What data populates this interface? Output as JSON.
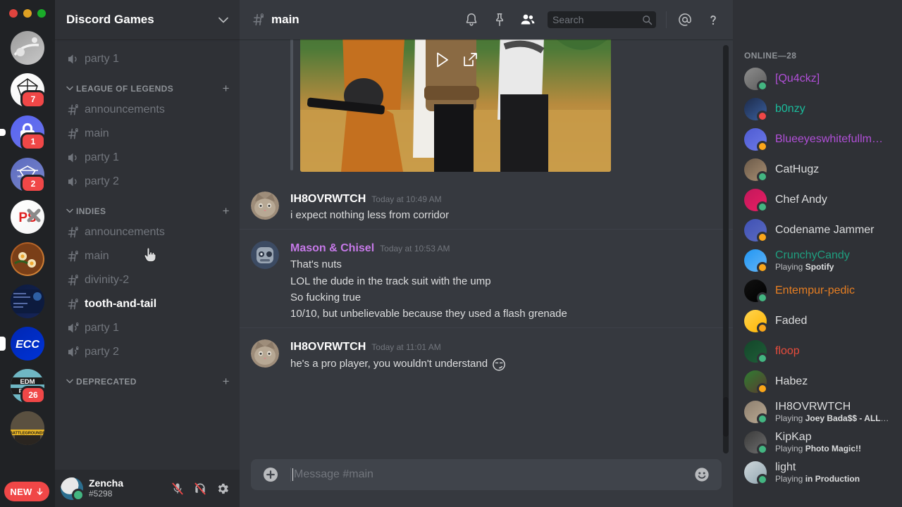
{
  "window": {
    "traffic_lights": [
      "close",
      "minimize",
      "maximize"
    ]
  },
  "server_rail": {
    "servers": [
      {
        "name": "mototrials-server",
        "badge": null,
        "pill": null,
        "colors": [
          "#9b9b9b",
          "#c8c8c8"
        ]
      },
      {
        "name": "owsla-server",
        "badge": "7",
        "pill": null,
        "colors": [
          "#ffffff",
          "#f2f2f2"
        ]
      },
      {
        "name": "lock-server",
        "badge": "1",
        "pill": "sm",
        "colors": [
          "#5865f2",
          "#6b74e8"
        ]
      },
      {
        "name": "hypesquad-server",
        "badge": "2",
        "pill": null,
        "colors": [
          "#5c6bc0",
          "#7986cb"
        ]
      },
      {
        "name": "red-pixel-server",
        "badge": null,
        "pill": null,
        "colors": [
          "#ffffff",
          "#f5f5f5"
        ]
      },
      {
        "name": "ramen-server",
        "badge": null,
        "pill": null,
        "colors": [
          "#a8541f",
          "#d98c3c"
        ]
      },
      {
        "name": "congratulations-server",
        "badge": null,
        "pill": null,
        "colors": [
          "#0d1b3e",
          "#16255a"
        ]
      },
      {
        "name": "ecc-server",
        "badge": null,
        "pill": "md",
        "colors": [
          "#0027b3",
          "#0033d6"
        ]
      },
      {
        "name": "edm-prod-server",
        "badge": "26",
        "pill": null,
        "colors": [
          "#6fb7c4",
          "#2b2b2b"
        ]
      },
      {
        "name": "battlegrounds-server",
        "badge": null,
        "pill": null,
        "colors": [
          "#4a4236",
          "#6b5f4c"
        ]
      }
    ],
    "new_pill_label": "NEW"
  },
  "sidebar": {
    "guild_name": "Discord Games",
    "collapse_icon": "chevron-down-icon",
    "orphan_channels": [
      {
        "label": "party 1",
        "type": "voice",
        "locked": false,
        "active": false
      }
    ],
    "categories": [
      {
        "label": "LEAGUE OF LEGENDS",
        "channels": [
          {
            "label": "announcements",
            "type": "text",
            "locked": true,
            "active": false
          },
          {
            "label": "main",
            "type": "text",
            "locked": true,
            "active": false
          },
          {
            "label": "party 1",
            "type": "voice",
            "locked": false,
            "active": false
          },
          {
            "label": "party 2",
            "type": "voice",
            "locked": false,
            "active": false
          }
        ]
      },
      {
        "label": "INDIES",
        "channels": [
          {
            "label": "announcements",
            "type": "text",
            "locked": true,
            "active": false
          },
          {
            "label": "main",
            "type": "text",
            "locked": true,
            "active": false
          },
          {
            "label": "divinity-2",
            "type": "text",
            "locked": true,
            "active": false
          },
          {
            "label": "tooth-and-tail",
            "type": "text",
            "locked": true,
            "active": true
          },
          {
            "label": "party 1",
            "type": "voice",
            "locked": true,
            "active": false
          },
          {
            "label": "party 2",
            "type": "voice",
            "locked": true,
            "active": false
          }
        ]
      },
      {
        "label": "DEPRECATED",
        "channels": []
      }
    ],
    "add_channel_icon": "plus-icon",
    "user_panel": {
      "username": "Zencha",
      "discriminator": "#5298",
      "status": "online",
      "mic_icon": "microphone-muted-icon",
      "headset_icon": "headset-deafened-icon",
      "settings_icon": "gear-icon"
    }
  },
  "header": {
    "channel_name": "main",
    "channel_icon": "hash-locked-icon",
    "actions": [
      {
        "name": "notifications-bell-icon",
        "glyph": "bell"
      },
      {
        "name": "pinned-messages-icon",
        "glyph": "pin"
      },
      {
        "name": "member-list-icon",
        "glyph": "people"
      }
    ],
    "search": {
      "placeholder": "Search",
      "icon": "search-icon",
      "value": ""
    },
    "mentions_icon": "at-mention-icon",
    "help_icon": "help-question-icon"
  },
  "chat": {
    "embed": {
      "type": "video-embed",
      "play_icon": "play-triangle-icon",
      "popout_icon": "popout-external-icon",
      "alt": "Four airsoft players posing with rifles in a forest"
    },
    "messages": [
      {
        "author": "IH8OVRWTCH",
        "author_color": "#ffffff",
        "timestamp": "Today at 10:49 AM",
        "avatar": "cat-avatar",
        "lines": [
          "i expect nothing less from corridor"
        ],
        "emoji": ""
      },
      {
        "author": "Mason & Chisel",
        "author_color": "#c679e8",
        "timestamp": "Today at 10:53 AM",
        "avatar": "robot-avatar",
        "lines": [
          "That's nuts",
          "LOL the dude in the track suit with the ump",
          "So fucking true",
          "10/10, but unbelievable because they used a flash grenade"
        ],
        "emoji": ""
      },
      {
        "author": "IH8OVRWTCH",
        "author_color": "#ffffff",
        "timestamp": "Today at 11:01 AM",
        "avatar": "cat-avatar",
        "lines": [
          "he's a pro player, you wouldn't understand"
        ],
        "emoji": "😏"
      }
    ],
    "composer": {
      "placeholder": "Message #main",
      "value": "",
      "attach_icon": "plus-circle-icon",
      "emoji_icon": "emoji-smiley-icon"
    }
  },
  "members": {
    "header": "ONLINE—28",
    "list": [
      {
        "name": "[Qu4ckz]",
        "color": "#b14fd8",
        "status": "online",
        "activity": null,
        "activity_app": null,
        "avatar": [
          "#8d8d8d",
          "#5b5b5b"
        ]
      },
      {
        "name": "b0nzy",
        "color": "#1abc9c",
        "status": "dnd",
        "activity": null,
        "activity_app": null,
        "avatar": [
          "#1d2b4a",
          "#3a5f9e"
        ]
      },
      {
        "name": "Blueeyeswhitefullm…",
        "color": "#b14fd8",
        "status": "idle",
        "activity": null,
        "activity_app": null,
        "avatar": [
          "#4e5bd2",
          "#6d7ae8"
        ]
      },
      {
        "name": "CatHugz",
        "color": "#dcddde",
        "status": "online",
        "activity": null,
        "activity_app": null,
        "avatar": [
          "#6b5a49",
          "#a88e72"
        ]
      },
      {
        "name": "Chef Andy",
        "color": "#dcddde",
        "status": "online",
        "activity": null,
        "activity_app": null,
        "avatar": [
          "#c2185b",
          "#e91e63"
        ]
      },
      {
        "name": "Codename Jammer",
        "color": "#dcddde",
        "status": "idle",
        "activity": null,
        "activity_app": null,
        "avatar": [
          "#3f51b5",
          "#5c6bc0"
        ]
      },
      {
        "name": "CrunchyCandy",
        "color": "#1f9e7f",
        "status": "idle",
        "activity": "Playing",
        "activity_app": "Spotify",
        "avatar": [
          "#2196f3",
          "#64b5f6"
        ]
      },
      {
        "name": "Entempur-pedic",
        "color": "#e67e22",
        "status": "online",
        "activity": null,
        "activity_app": null,
        "avatar": [
          "#111111",
          "#000000"
        ]
      },
      {
        "name": "Faded",
        "color": "#dcddde",
        "status": "idle",
        "activity": null,
        "activity_app": null,
        "avatar": [
          "#ffd54f",
          "#ffb300"
        ]
      },
      {
        "name": "floop",
        "color": "#e74c3c",
        "status": "online",
        "activity": null,
        "activity_app": null,
        "avatar": [
          "#14462a",
          "#1e5f38"
        ]
      },
      {
        "name": "Habez",
        "color": "#dcddde",
        "status": "idle",
        "activity": null,
        "activity_app": null,
        "avatar": [
          "#2e7d32",
          "#5a3b2e"
        ]
      },
      {
        "name": "IH8OVRWTCH",
        "color": "#dcddde",
        "status": "online",
        "activity": "Playing",
        "activity_app": "Joey Bada$$ - ALL A…",
        "avatar": [
          "#8d7f6f",
          "#b9a992"
        ]
      },
      {
        "name": "KipKap",
        "color": "#dcddde",
        "status": "online",
        "activity": "Playing",
        "activity_app": "Photo Magic!!",
        "avatar": [
          "#3a3a3a",
          "#6e6e6e"
        ]
      },
      {
        "name": "light",
        "color": "#dcddde",
        "status": "online",
        "activity": "Playing",
        "activity_app": "in Production",
        "avatar": [
          "#cfd8dc",
          "#90a4ae"
        ]
      }
    ]
  },
  "colors": {
    "rail_bg": "#202225",
    "sidebar_bg": "#2f3136",
    "chat_bg": "#36393f",
    "accent_badge": "#f04747",
    "online": "#43b581",
    "idle": "#faa61a",
    "dnd": "#f04747"
  }
}
